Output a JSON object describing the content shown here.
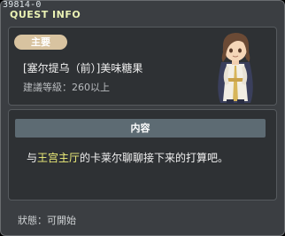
{
  "window": {
    "quest_id": "39814-0",
    "title": "QUEST INFO"
  },
  "quest": {
    "badge": "主要",
    "name": "[塞尔提乌（前）]美味糖果",
    "level_requirement": "建議等級：260以上"
  },
  "npc": {
    "icon": "npc-character-icon"
  },
  "content": {
    "section_label": "内容",
    "description_prefix": "与",
    "description_highlight": "王宫主厅",
    "description_suffix": "的卡莱尔聊聊接下来的打算吧。"
  },
  "status": {
    "text": "狀態：可開始"
  },
  "colors": {
    "window_bg": "#3b3e42",
    "panel_bg": "#2e3134",
    "title": "#eaf2b4",
    "badge_bg": "#d8c3a0",
    "section_bar": "#5d6b73",
    "highlight": "#f0f07a"
  }
}
